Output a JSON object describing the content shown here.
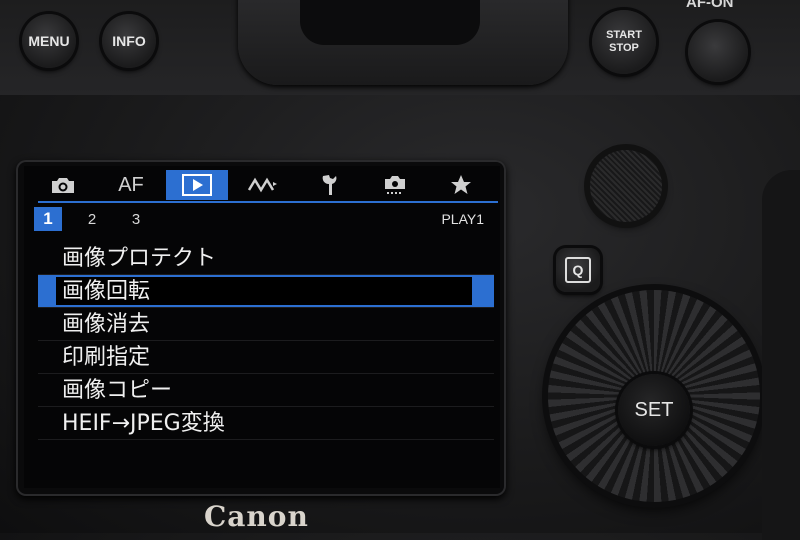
{
  "camera": {
    "brand_logo": "Canon",
    "buttons": {
      "menu": "MENU",
      "info": "INFO",
      "start_stop_line1": "START",
      "start_stop_line2": "STOP",
      "af_on": "AF-ON",
      "q": "Q",
      "set": "SET"
    }
  },
  "screen": {
    "tabs": [
      {
        "id": "shooting",
        "icon": "camera-icon"
      },
      {
        "id": "af",
        "label": "AF"
      },
      {
        "id": "playback",
        "icon": "play-icon",
        "active": true
      },
      {
        "id": "network",
        "icon": "wireless-icon"
      },
      {
        "id": "setup",
        "icon": "wrench-icon"
      },
      {
        "id": "custom",
        "icon": "custom-camera-icon"
      },
      {
        "id": "mymenu",
        "icon": "star-icon"
      }
    ],
    "subtabs": [
      "1",
      "2",
      "3"
    ],
    "active_subtab": "1",
    "page_label": "PLAY1",
    "menu_items": [
      "画像プロテクト",
      "画像回転",
      "画像消去",
      "印刷指定",
      "画像コピー",
      "HEIF→JPEG変換"
    ],
    "selected_index": 1,
    "accent_color": "#2c6fd1"
  }
}
